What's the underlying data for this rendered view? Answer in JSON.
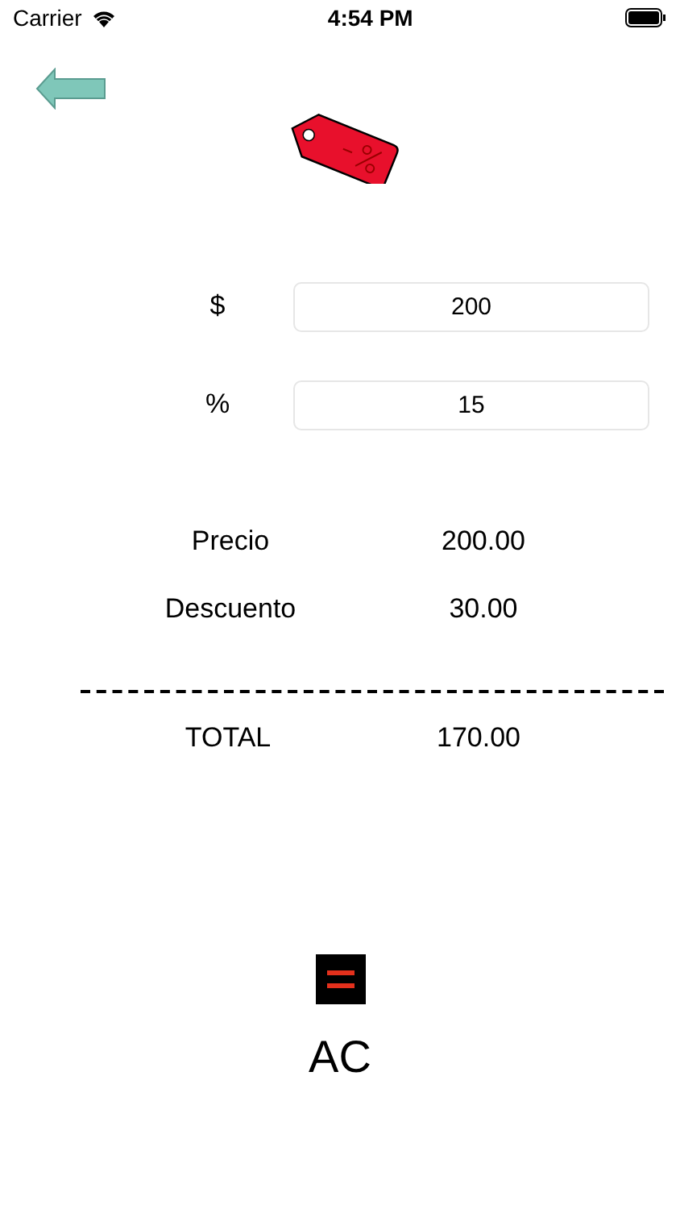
{
  "status_bar": {
    "carrier": "Carrier",
    "time": "4:54 PM"
  },
  "inputs": [
    {
      "label": "$",
      "value": "200"
    },
    {
      "label": "%",
      "value": "15"
    }
  ],
  "summary": [
    {
      "label": "Precio",
      "value": "200.00"
    },
    {
      "label": "Descuento",
      "value": "30.00"
    }
  ],
  "total": {
    "label": "TOTAL",
    "value": "170.00"
  },
  "clear_button": {
    "label": "AC"
  }
}
